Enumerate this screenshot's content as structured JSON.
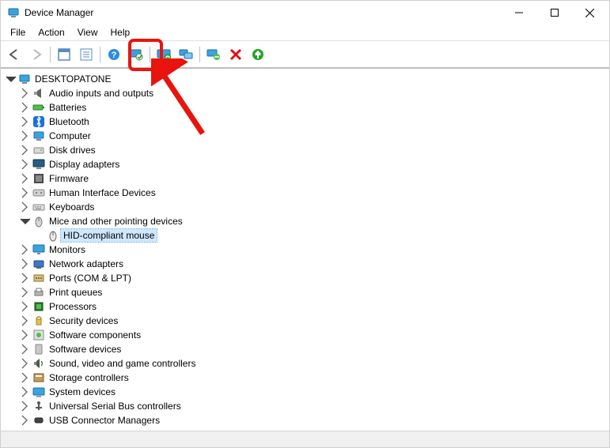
{
  "title": "Device Manager",
  "menubar": [
    "File",
    "Action",
    "View",
    "Help"
  ],
  "root": "DESKTOPATONE",
  "categories": [
    {
      "label": "Audio inputs and outputs",
      "icon": "audio",
      "expanded": false
    },
    {
      "label": "Batteries",
      "icon": "battery",
      "expanded": false
    },
    {
      "label": "Bluetooth",
      "icon": "bluetooth",
      "expanded": false
    },
    {
      "label": "Computer",
      "icon": "computer",
      "expanded": false
    },
    {
      "label": "Disk drives",
      "icon": "disk",
      "expanded": false
    },
    {
      "label": "Display adapters",
      "icon": "display",
      "expanded": false
    },
    {
      "label": "Firmware",
      "icon": "firmware",
      "expanded": false
    },
    {
      "label": "Human Interface Devices",
      "icon": "hid",
      "expanded": false
    },
    {
      "label": "Keyboards",
      "icon": "keyboard",
      "expanded": false
    },
    {
      "label": "Mice and other pointing devices",
      "icon": "mouse",
      "expanded": true,
      "children": [
        {
          "label": "HID-compliant mouse",
          "icon": "mouse-dev",
          "selected": true
        }
      ]
    },
    {
      "label": "Monitors",
      "icon": "monitor",
      "expanded": false
    },
    {
      "label": "Network adapters",
      "icon": "network",
      "expanded": false
    },
    {
      "label": "Ports (COM & LPT)",
      "icon": "port",
      "expanded": false
    },
    {
      "label": "Print queues",
      "icon": "printer",
      "expanded": false
    },
    {
      "label": "Processors",
      "icon": "cpu",
      "expanded": false
    },
    {
      "label": "Security devices",
      "icon": "security",
      "expanded": false
    },
    {
      "label": "Software components",
      "icon": "swcomp",
      "expanded": false
    },
    {
      "label": "Software devices",
      "icon": "swdev",
      "expanded": false
    },
    {
      "label": "Sound, video and game controllers",
      "icon": "sound",
      "expanded": false
    },
    {
      "label": "Storage controllers",
      "icon": "storage",
      "expanded": false
    },
    {
      "label": "System devices",
      "icon": "system",
      "expanded": false
    },
    {
      "label": "Universal Serial Bus controllers",
      "icon": "usb",
      "expanded": false
    },
    {
      "label": "USB Connector Managers",
      "icon": "usbconn",
      "expanded": false
    }
  ]
}
